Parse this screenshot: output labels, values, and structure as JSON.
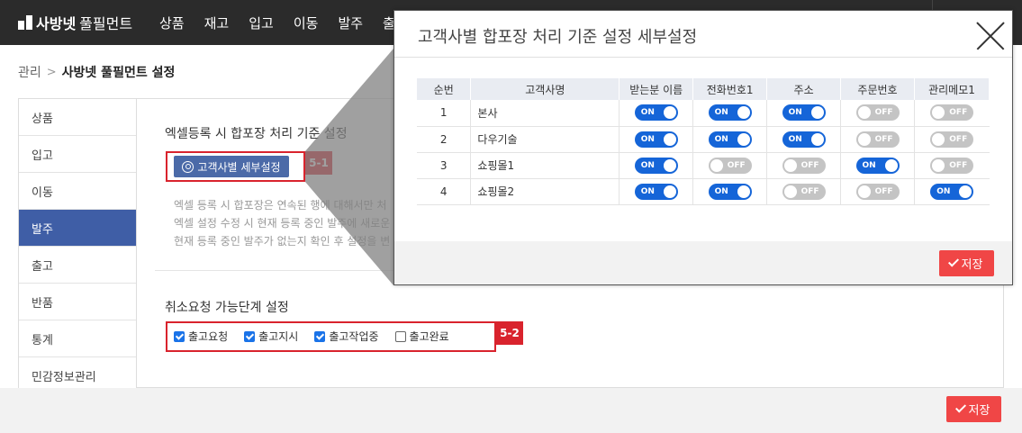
{
  "logo": {
    "name": "사방넷",
    "sub": "풀필먼트"
  },
  "nav": [
    "상품",
    "재고",
    "입고",
    "이동",
    "발주",
    "출"
  ],
  "breadcrumb": {
    "root": "관리",
    "separator": ">",
    "current": "사방넷 풀필먼트 설정"
  },
  "sidebar": [
    {
      "label": "상품"
    },
    {
      "label": "입고"
    },
    {
      "label": "이동"
    },
    {
      "label": "발주",
      "active": true
    },
    {
      "label": "출고"
    },
    {
      "label": "반품"
    },
    {
      "label": "통계"
    },
    {
      "label": "민감정보관리"
    }
  ],
  "section1": {
    "title": "엑셀등록 시 합포장 처리 기준 설정",
    "button_label": "고객사별 세부설정",
    "tag": "5-1",
    "help_lines": [
      "엑셀 등록 시 합포장은 연속된 행에 대해서만 처",
      "엑셀 설정 수정 시 현재 등록 중인 발주에 새로운",
      "현재 등록 중인 발주가 없는지 확인 후 설정을 변"
    ]
  },
  "section2": {
    "title": "취소요청 가능단계 설정",
    "tag": "5-2",
    "options": [
      {
        "label": "출고요청",
        "checked": true
      },
      {
        "label": "출고지시",
        "checked": true
      },
      {
        "label": "출고작업중",
        "checked": true
      },
      {
        "label": "출고완료",
        "checked": false
      }
    ]
  },
  "footer": {
    "save_label": "저장"
  },
  "modal": {
    "title": "고객사별 합포장 처리 기준 설정 세부설정",
    "columns": [
      "순번",
      "고객사명",
      "받는분 이름",
      "전화번호1",
      "주소",
      "주문번호",
      "관리메모1"
    ],
    "on_text": "ON",
    "off_text": "OFF",
    "rows": [
      {
        "no": "1",
        "name": "본사",
        "toggles": [
          true,
          true,
          true,
          false,
          false
        ]
      },
      {
        "no": "2",
        "name": "다우기술",
        "toggles": [
          true,
          true,
          true,
          false,
          false
        ]
      },
      {
        "no": "3",
        "name": "쇼핑몰1",
        "toggles": [
          true,
          false,
          false,
          true,
          false
        ]
      },
      {
        "no": "4",
        "name": "쇼핑몰2",
        "toggles": [
          true,
          true,
          false,
          false,
          true
        ]
      }
    ],
    "save_label": "저장"
  },
  "colors": {
    "active_sidebar": "#3f5ea6",
    "highlight_red": "#d9232d",
    "save_red": "#f04646",
    "toggle_on": "#1565d8",
    "toggle_off": "#c4c4c4"
  }
}
